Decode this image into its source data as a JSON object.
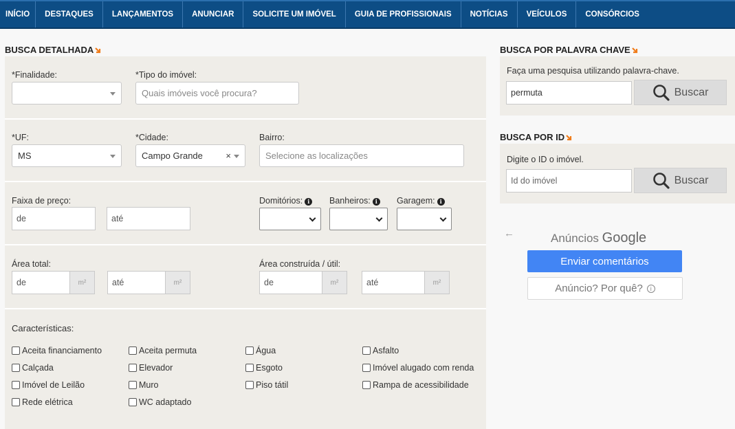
{
  "nav": {
    "items": [
      {
        "label": "INÍCIO"
      },
      {
        "label": "DESTAQUES"
      },
      {
        "label": "LANÇAMENTOS"
      },
      {
        "label": "ANUNCIAR"
      },
      {
        "label": "SOLICITE UM IMÓVEL"
      },
      {
        "label": "GUIA DE PROFISSIONAIS"
      },
      {
        "label": "NOTÍCIAS"
      },
      {
        "label": "VEÍCULOS"
      },
      {
        "label": "CONSÓRCIOS"
      }
    ]
  },
  "detailed": {
    "title": "BUSCA DETALHADA",
    "finalidade": {
      "label": "*Finalidade:",
      "value": ""
    },
    "tipo": {
      "label": "*Tipo do imóvel:",
      "placeholder": "Quais imóveis você procura?"
    },
    "uf": {
      "label": "*UF:",
      "value": "MS"
    },
    "cidade": {
      "label": "*Cidade:",
      "value": "Campo Grande",
      "clear": "×"
    },
    "bairro": {
      "label": "Bairro:",
      "placeholder": "Selecione as localizações"
    },
    "preco": {
      "label": "Faixa de preço:",
      "from": "de",
      "to": "até"
    },
    "dormitorios": {
      "label": "Domitórios:"
    },
    "banheiros": {
      "label": "Banheiros:"
    },
    "garagem": {
      "label": "Garagem:"
    },
    "info_glyph": "i",
    "area_total": {
      "label": "Área total:",
      "from": "de",
      "to": "até",
      "unit": "m²"
    },
    "area_construida": {
      "label": "Área construída / útil:",
      "from": "de",
      "to": "até",
      "unit": "m²"
    },
    "caracteristicas": {
      "title": "Características:",
      "items": [
        "Aceita financiamento",
        "Aceita permuta",
        "Água",
        "Asfalto",
        "Calçada",
        "Elevador",
        "Esgoto",
        "Imóvel alugado com renda",
        "Imóvel de Leilão",
        "Muro",
        "Piso tátil",
        "Rampa de acessibilidade",
        "Rede elétrica",
        "WC adaptado"
      ]
    }
  },
  "keyword": {
    "title": "BUSCA POR PALAVRA CHAVE",
    "hint": "Faça uma pesquisa utilizando palavra-chave.",
    "value": "permuta",
    "button": "Buscar"
  },
  "byid": {
    "title": "BUSCA POR ID",
    "hint": "Digite o ID o imóvel.",
    "placeholder": "Id do imóvel",
    "button": "Buscar"
  },
  "ads": {
    "label_prefix": "Anúncios",
    "label_brand": "Google",
    "back_arrow": "←",
    "feedback_button": "Enviar comentários",
    "why_button": "Anúncio? Por quê?",
    "why_icon": "i"
  },
  "colors": {
    "nav_bg": "#0d4d85",
    "panel_bg": "#efede8",
    "ad_primary": "#4285f4",
    "arrow_accent": "#f07c1a"
  },
  "icons": {
    "section_arrow": "arrow-down-right-icon",
    "search": "magnifier-icon",
    "info": "info-circle-icon"
  }
}
